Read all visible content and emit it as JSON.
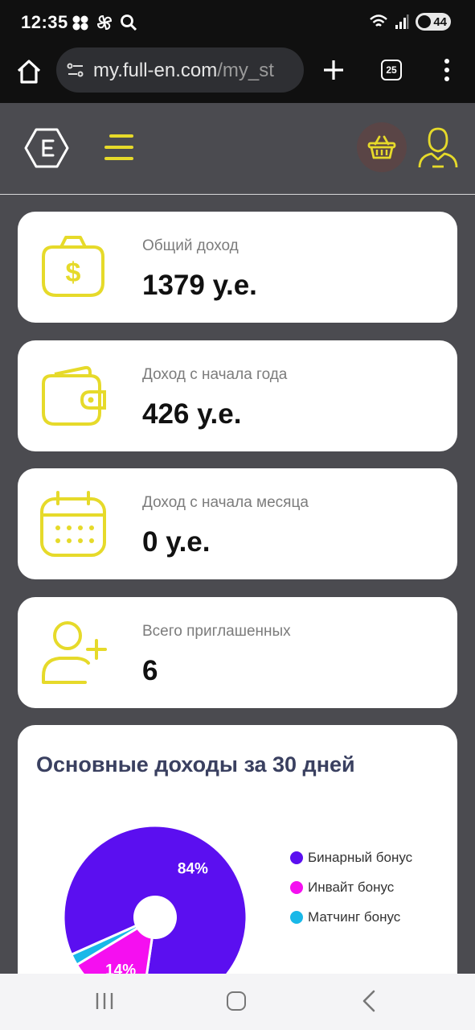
{
  "status_bar": {
    "time": "12:35",
    "battery": "44"
  },
  "browser": {
    "url_main": "my.full-en.com",
    "url_path": "/my_st",
    "tab_count": "25"
  },
  "cards": [
    {
      "label": "Общий доход",
      "value": "1379 у.е.",
      "icon": "money-bag-icon"
    },
    {
      "label": "Доход с начала года",
      "value": "426 у.е.",
      "icon": "wallet-icon"
    },
    {
      "label": "Доход с начала месяца",
      "value": "0 у.е.",
      "icon": "calendar-icon"
    },
    {
      "label": "Всего приглашенных",
      "value": "6",
      "icon": "user-add-icon"
    }
  ],
  "colors": {
    "accent": "#e6da2a",
    "purple": "#5b0ff0",
    "magenta": "#f50ff0",
    "cyan": "#19b8e8"
  },
  "chart_card": {
    "title": "Основные доходы за 30 дней"
  },
  "chart_data": {
    "type": "pie",
    "title": "Основные доходы за 30 дней",
    "series": [
      {
        "name": "Бинарный бонус",
        "value": 84,
        "label": "84%",
        "color": "#5b0ff0"
      },
      {
        "name": "Инвайт бонус",
        "value": 14,
        "label": "14%",
        "color": "#f50ff0"
      },
      {
        "name": "Матчинг бонус",
        "value": 2,
        "label": "",
        "color": "#19b8e8"
      }
    ],
    "legend": "right"
  }
}
